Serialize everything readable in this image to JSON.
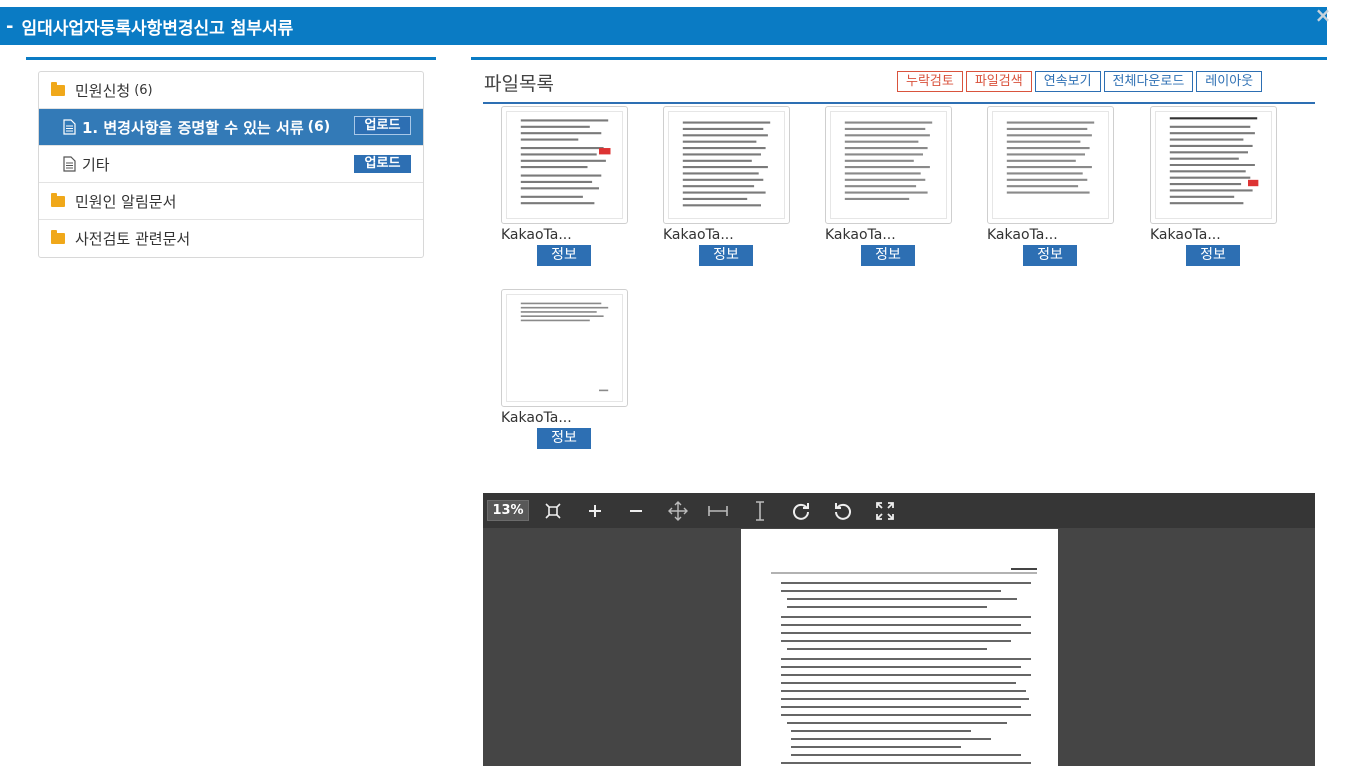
{
  "header": {
    "collapse_symbol": "-",
    "title": "임대사업자등록사항변경신고 첨부서류",
    "close_symbol": "×"
  },
  "tree": {
    "folder_apply": {
      "label": "민원신청",
      "count": "(6)"
    },
    "doc_change": {
      "label": "1. 변경사항을 증명할 수 있는 서류",
      "count": "(6)",
      "upload": "업로드"
    },
    "doc_other": {
      "label": "기타",
      "upload": "업로드"
    },
    "folder_notice": {
      "label": "민원인 알림문서"
    },
    "folder_review": {
      "label": "사전검토 관련문서"
    }
  },
  "file_list": {
    "title": "파일목록",
    "toolbar": {
      "missing_check": "누락검토",
      "file_search": "파일검색",
      "continuous_view": "연속보기",
      "download_all": "전체다운로드",
      "layout": "레이아웃"
    },
    "files": [
      {
        "name": "KakaoTa...",
        "info": "정보"
      },
      {
        "name": "KakaoTa...",
        "info": "정보"
      },
      {
        "name": "KakaoTa...",
        "info": "정보"
      },
      {
        "name": "KakaoTa...",
        "info": "정보"
      },
      {
        "name": "KakaoTa...",
        "info": "정보"
      },
      {
        "name": "KakaoTa...",
        "info": "정보"
      }
    ]
  },
  "viewer": {
    "zoom": "13%",
    "tools": [
      "fit-page-icon",
      "zoom-in-icon",
      "zoom-out-icon",
      "fit-both-icon",
      "fit-width-icon",
      "fit-height-icon",
      "rotate-clockwise-icon",
      "rotate-counterclockwise-icon",
      "fullscreen-icon"
    ]
  },
  "colors": {
    "primary": "#0a7bc4",
    "button_blue": "#2d6fb3",
    "folder": "#f0a81a",
    "alert_red": "#d9533d",
    "viewer_bg": "#454545"
  }
}
